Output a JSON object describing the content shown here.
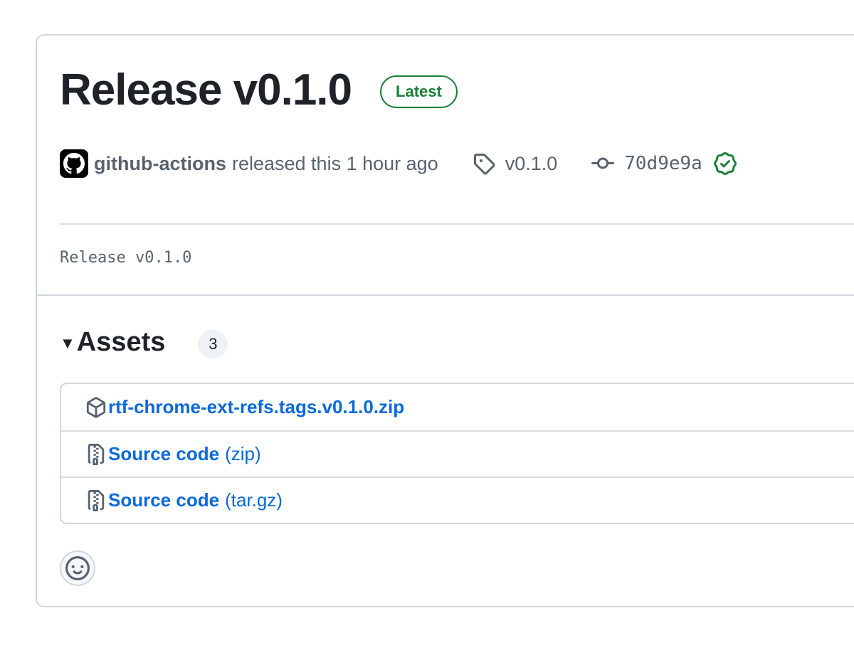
{
  "release": {
    "title": "Release v0.1.0",
    "badge": "Latest",
    "author": "github-actions",
    "released_text": "released this 1 hour ago",
    "tag": "v0.1.0",
    "commit": "70d9e9a",
    "body": "Release v0.1.0"
  },
  "assets": {
    "title": "Assets",
    "count": "3",
    "items": [
      {
        "name": "rtf-chrome-ext-refs.tags.v0.1.0.zip",
        "suffix": "",
        "icon": "package-icon"
      },
      {
        "name": "Source code",
        "suffix": "(zip)",
        "icon": "file-zip-icon"
      },
      {
        "name": "Source code",
        "suffix": "(tar.gz)",
        "icon": "file-zip-icon"
      }
    ]
  },
  "colors": {
    "accent": "#0969da",
    "success": "#1a7f37",
    "muted": "#59636e",
    "border": "#d0d7de"
  }
}
